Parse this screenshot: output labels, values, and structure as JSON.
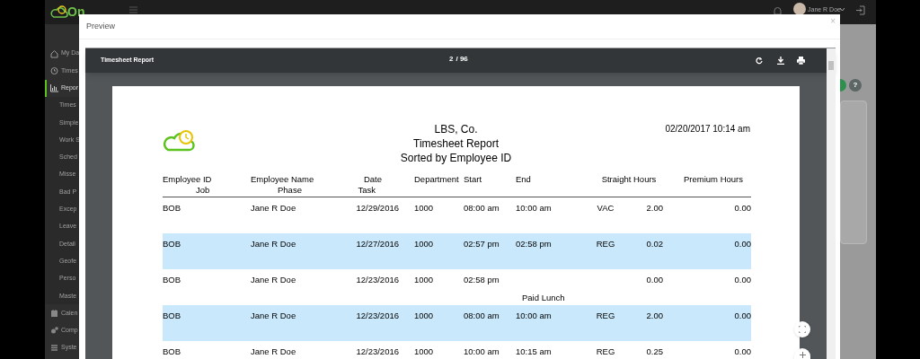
{
  "app": {
    "logo": "On",
    "user": "Jane R Doe",
    "help": "?"
  },
  "sidebar": {
    "items": [
      {
        "label": "My Da",
        "kind": "section",
        "selected": false
      },
      {
        "label": "Times",
        "kind": "section",
        "selected": false
      },
      {
        "label": "Repor",
        "kind": "section",
        "selected": true
      },
      {
        "label": "Times",
        "kind": "subitem",
        "selected": false
      },
      {
        "label": "Simple",
        "kind": "subitem",
        "selected": false
      },
      {
        "label": "Work S",
        "kind": "subitem",
        "selected": false
      },
      {
        "label": "Sched",
        "kind": "subitem",
        "selected": false
      },
      {
        "label": "Misse",
        "kind": "subitem",
        "selected": false
      },
      {
        "label": "Bad P",
        "kind": "subitem",
        "selected": false
      },
      {
        "label": "Excep",
        "kind": "subitem",
        "selected": false
      },
      {
        "label": "Leave",
        "kind": "subitem",
        "selected": false
      },
      {
        "label": "Detail",
        "kind": "subitem",
        "selected": false
      },
      {
        "label": "Geofe",
        "kind": "subitem",
        "selected": false
      },
      {
        "label": "Perso",
        "kind": "subitem",
        "selected": false
      },
      {
        "label": "Maste",
        "kind": "subitem",
        "selected": false
      },
      {
        "label": "Calen",
        "kind": "section",
        "selected": false
      },
      {
        "label": "Comp",
        "kind": "section",
        "selected": false
      },
      {
        "label": "Syste",
        "kind": "section",
        "selected": false
      }
    ]
  },
  "modal": {
    "title": "Preview",
    "close": "×"
  },
  "viewer": {
    "title": "Timesheet Report",
    "page": "2",
    "pages": "/ 96"
  },
  "report": {
    "company": "LBS, Co.",
    "title": "Timesheet Report",
    "subtitle": "Sorted by Employee ID",
    "printed": "02/20/2017 10:14 am",
    "columns": [
      {
        "line1": "Employee ID",
        "line2": "Job"
      },
      {
        "line1": "Employee Name",
        "line2": "Phase"
      },
      {
        "line1": "Date",
        "line2": "Task"
      },
      {
        "line1": "Department"
      },
      {
        "line1": "Start"
      },
      {
        "line1": "End"
      },
      {
        "line1": "Straight Hours"
      },
      {
        "line1": "Premium Hours"
      }
    ],
    "rows": [
      {
        "highlighted": false,
        "cells": [
          "BOB",
          "Jane R Doe",
          "12/29/2016",
          "1000",
          "08:00 am",
          "10:00 am",
          "VAC",
          "2.00",
          "0.00"
        ]
      },
      {
        "highlighted": true,
        "cells": [
          "BOB",
          "Jane R Doe",
          "12/27/2016",
          "1000",
          "02:57 pm",
          "02:58 pm",
          "REG",
          "0.02",
          "0.00"
        ]
      },
      {
        "highlighted": false,
        "cells": [
          "BOB",
          "Jane R Doe",
          "12/23/2016",
          "1000",
          "02:58 pm",
          null,
          null,
          "0.00",
          "0.00"
        ],
        "note": "Paid Lunch"
      },
      {
        "highlighted": true,
        "cells": [
          "BOB",
          "Jane R Doe",
          "12/23/2016",
          "1000",
          "08:00 am",
          "10:00 am",
          "REG",
          "2.00",
          "0.00"
        ]
      },
      {
        "highlighted": false,
        "cells": [
          "BOB",
          "Jane R Doe",
          "12/23/2016",
          "1000",
          "10:00 am",
          "10:15 am",
          "REG",
          "0.25",
          "0.00"
        ]
      }
    ]
  }
}
